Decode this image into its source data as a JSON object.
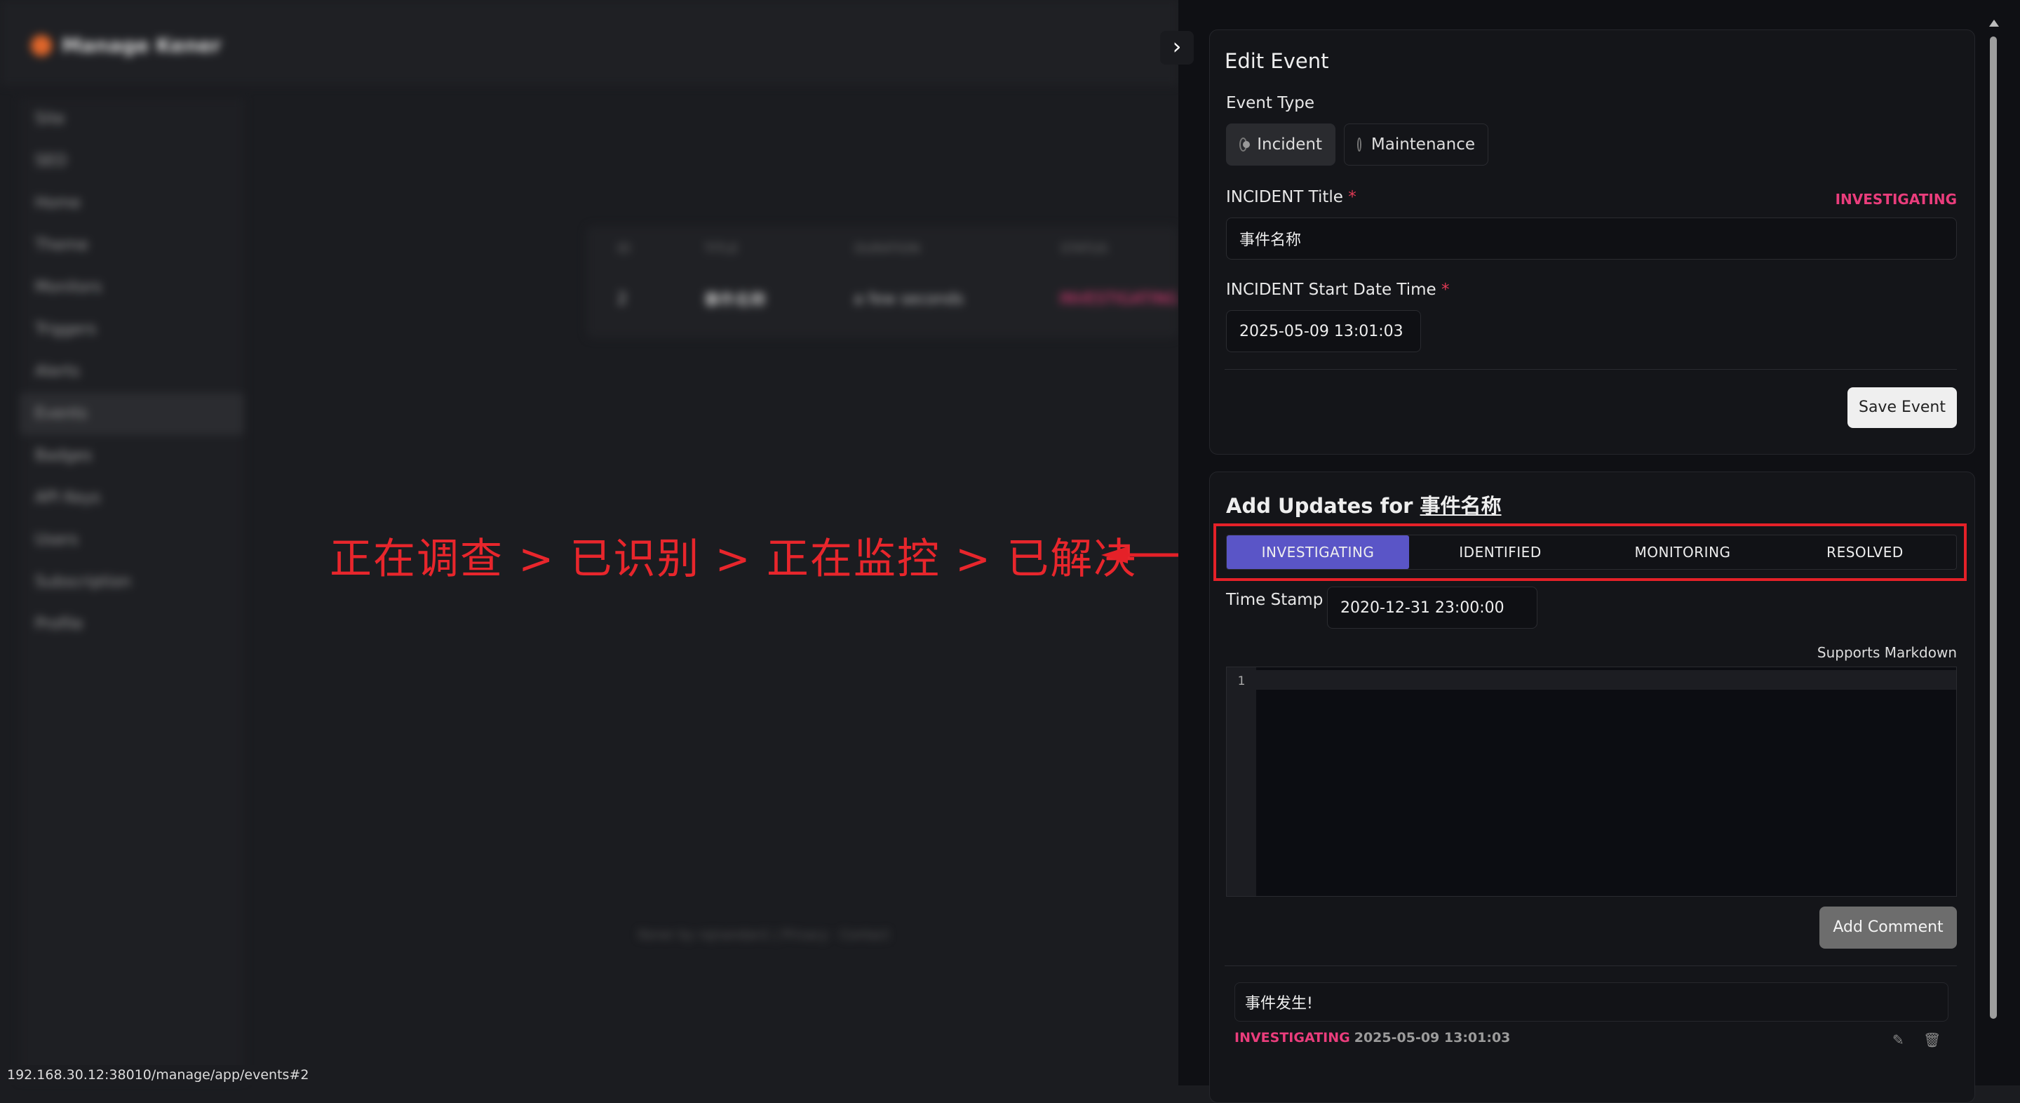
{
  "background": {
    "app_name": "Manage Kener",
    "sidebar": [
      "Site",
      "SEO",
      "Home",
      "Theme",
      "Monitors",
      "Triggers",
      "Alerts",
      "Events",
      "Badges",
      "API Keys",
      "Users",
      "Subscription",
      "Profile"
    ],
    "table": {
      "headers": [
        "ID",
        "TITLE",
        "DURATION",
        "STATUS"
      ],
      "row": [
        "2",
        "事件名称",
        "a few seconds",
        "INVESTIGATING"
      ]
    },
    "footer": "Kener by rajnandan1 | Privacy · Contact",
    "status_url": "192.168.30.12:38010/manage/app/events#2"
  },
  "annotation": {
    "text": "正在调查 > 已识别 > 正在监控 > 已解决",
    "color": "#e8262c"
  },
  "edit_event": {
    "title": "Edit Event",
    "event_type_label": "Event Type",
    "options": [
      "Incident",
      "Maintenance"
    ],
    "selected": "Incident",
    "title_label": "INCIDENT Title",
    "required_mark": "*",
    "status_badge": "INVESTIGATING",
    "title_value": "事件名称",
    "start_label": "INCIDENT Start Date Time",
    "start_value": "2025-05-09 13:01:03",
    "save_button": "Save Event"
  },
  "updates": {
    "heading_prefix": "Add Updates for",
    "heading_name": "事件名称",
    "tabs": [
      "INVESTIGATING",
      "IDENTIFIED",
      "MONITORING",
      "RESOLVED"
    ],
    "active_tab": "INVESTIGATING",
    "timestamp_label": "Time Stamp",
    "timestamp_value": "2020-12-31 23:00:00",
    "markdown_note": "Supports Markdown",
    "editor_line": "1",
    "add_comment": "Add Comment",
    "comment": {
      "text": "事件发生!",
      "status": "INVESTIGATING",
      "time": "2025-05-09 13:01:03"
    }
  },
  "colors": {
    "accent": "#5a55c7",
    "status_pink": "#ea3d7c",
    "annotation_red": "#e52128"
  }
}
